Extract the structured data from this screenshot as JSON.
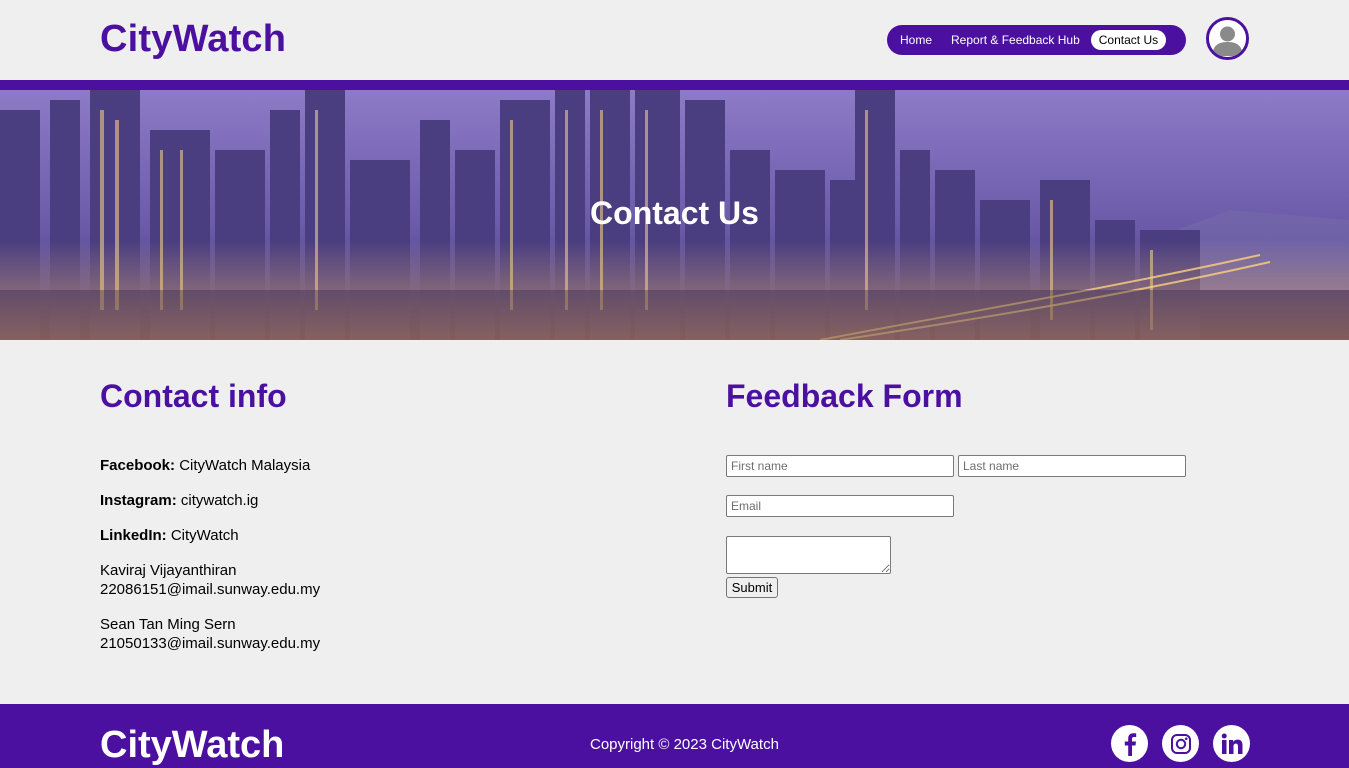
{
  "header": {
    "brand": "CityWatch",
    "nav": [
      "Home",
      "Report & Feedback Hub",
      "Contact Us"
    ],
    "active_nav": "Contact Us",
    "avatar_icon": "user-avatar-icon"
  },
  "hero": {
    "title": "Contact Us"
  },
  "contact": {
    "title": "Contact info",
    "facebook_label": "Facebook:",
    "facebook_value": "CityWatch Malaysia",
    "instagram_label": "Instagram:",
    "instagram_value": "citywatch.ig",
    "linkedin_label": "LinkedIn:",
    "linkedin_value": "CityWatch",
    "people": [
      {
        "name": "Kaviraj Vijayanthiran",
        "email": "22086151@imail.sunway.edu.my"
      },
      {
        "name": "Sean Tan Ming Sern",
        "email": "21050133@imail.sunway.edu.my"
      }
    ]
  },
  "form": {
    "title": "Feedback Form",
    "first_name_placeholder": "First name",
    "last_name_placeholder": "Last name",
    "email_placeholder": "Email",
    "submit_label": "Submit"
  },
  "footer": {
    "brand": "CityWatch",
    "copyright": "Copyright © 2023 CityWatch",
    "social_icons": [
      "facebook-icon",
      "instagram-icon",
      "linkedin-icon"
    ]
  },
  "colors": {
    "brand_purple": "#4b10a0",
    "background": "#efefef"
  }
}
